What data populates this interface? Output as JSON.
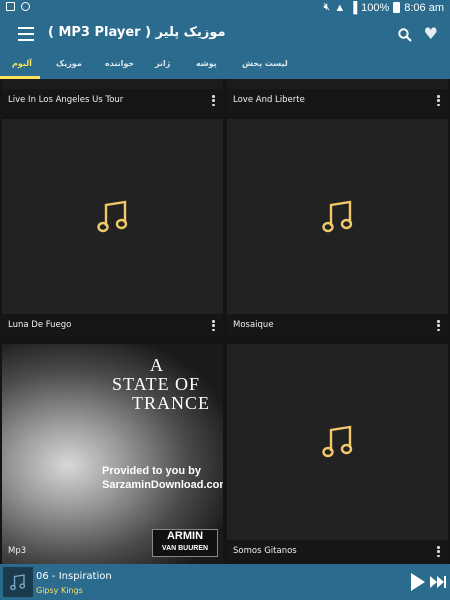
{
  "status_bar": {
    "battery": "100%",
    "time": "8:06 am"
  },
  "app_bar": {
    "title": "موزیک پلیر ( MP3 Player )"
  },
  "tabs": [
    {
      "label": "لیست پخش",
      "active": false
    },
    {
      "label": "پوشه",
      "active": false
    },
    {
      "label": "ژانر",
      "active": false
    },
    {
      "label": "خواننده",
      "active": false
    },
    {
      "label": "موزیک",
      "active": false
    },
    {
      "label": "آلبوم",
      "active": true
    }
  ],
  "albums": [
    {
      "title": "Live In Los Angeles Us Tour",
      "art": "none"
    },
    {
      "title": "Love And Liberte",
      "art": "none"
    },
    {
      "title": "Luna De Fuego",
      "art": "music-note-icon"
    },
    {
      "title": "Mosaique",
      "art": "music-note-icon"
    },
    {
      "title": "Mp3",
      "art": "cover-image"
    },
    {
      "title": "Somos Gitanos",
      "art": "music-note-icon"
    }
  ],
  "cover": {
    "headline": [
      "A",
      "STATE OF",
      "TRANCE"
    ],
    "provided": [
      "Provided to you by",
      "SarzaminDownload.com"
    ],
    "brand": [
      "ARMIN",
      "VAN BUUREN"
    ]
  },
  "now_playing": {
    "title": "06 - Inspiration",
    "artist": "Gipsy Kings"
  },
  "colors": {
    "accent": "#2a6b8e",
    "highlight": "#fde15a",
    "note": "#f2c96a"
  }
}
